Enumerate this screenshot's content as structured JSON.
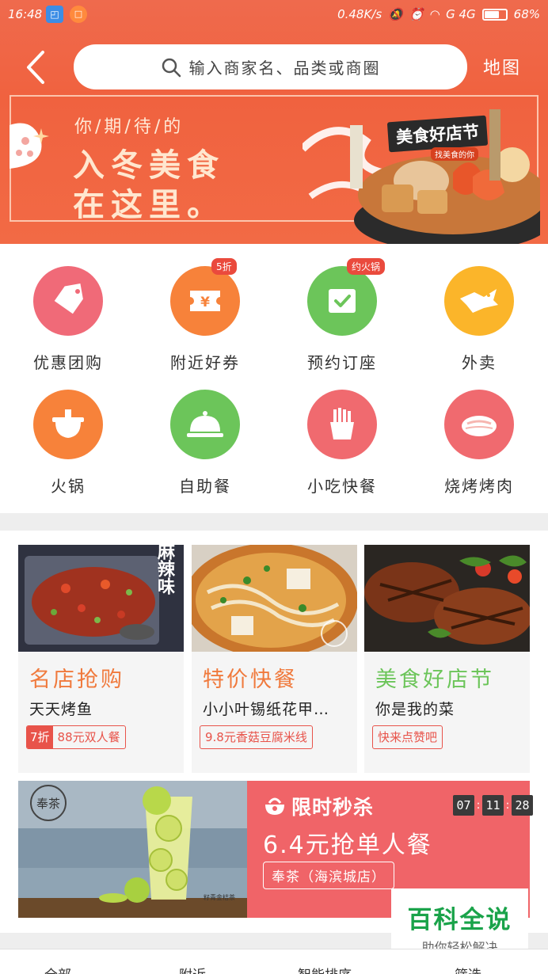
{
  "status_bar": {
    "time": "16:48",
    "net_speed": "0.48K/s",
    "network": "G  4G",
    "battery": "68%",
    "battery_level": 0.68
  },
  "header": {
    "search_placeholder": "输入商家名、品类或商圈",
    "map_label": "地图"
  },
  "banner": {
    "subtitle": "你/期/待/的",
    "title_line1": "入冬美食",
    "title_line2": "在这里。",
    "badge": "美食好店节",
    "badge_sub": "找美食的你"
  },
  "categories": [
    {
      "label": "优惠团购",
      "icon": "tag-icon",
      "color": "#f06a78",
      "badge": ""
    },
    {
      "label": "附近好券",
      "icon": "coupon-icon",
      "color": "#f7823a",
      "badge": "5折"
    },
    {
      "label": "预约订座",
      "icon": "check-icon",
      "color": "#6cc55a",
      "badge": "约火锅"
    },
    {
      "label": "外卖",
      "icon": "delivery-icon",
      "color": "#fbb52a",
      "badge": ""
    },
    {
      "label": "火锅",
      "icon": "hotpot-icon",
      "color": "#f7823a",
      "badge": ""
    },
    {
      "label": "自助餐",
      "icon": "cloche-icon",
      "color": "#6cc55a",
      "badge": ""
    },
    {
      "label": "小吃快餐",
      "icon": "fries-icon",
      "color": "#f06a6f",
      "badge": ""
    },
    {
      "label": "烧烤烤肉",
      "icon": "meat-icon",
      "color": "#f06a6f",
      "badge": ""
    }
  ],
  "promo_cards": [
    {
      "title": "名店抢购",
      "title_color": "#f07a3d",
      "name": "天天烤鱼",
      "hot_tag": "7折",
      "tag": "88元双人餐",
      "image_text": "麻辣味"
    },
    {
      "title": "特价快餐",
      "title_color": "#f07a3d",
      "name": "小小叶锡纸花甲…",
      "hot_tag": "",
      "tag": "9.8元香菇豆腐米线",
      "image_text": ""
    },
    {
      "title": "美食好店节",
      "title_color": "#6cc55a",
      "name": "你是我的菜",
      "hot_tag": "",
      "tag": "快来点赞吧",
      "image_text": ""
    }
  ],
  "flash_sale": {
    "title": "限时秒杀",
    "price_text": "6.4元抢单人餐",
    "shop": "奉茶（海滨城店）",
    "timer": [
      "07",
      "11",
      "28"
    ],
    "logo_text": "奉茶",
    "drink_label": "籽青金桔茶"
  },
  "watermark": {
    "title": "百科全说",
    "subtitle": "助你轻松解决"
  },
  "bottom_tabs": [
    "全部",
    "附近",
    "智能排序",
    "筛选"
  ]
}
